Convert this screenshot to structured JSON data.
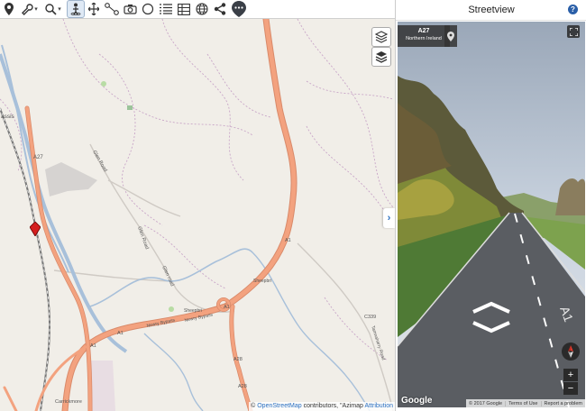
{
  "toolbar": {
    "tools": [
      {
        "name": "place-pin-icon"
      },
      {
        "name": "wrench-icon",
        "dropdown": true
      },
      {
        "name": "search-icon",
        "dropdown": true
      },
      {
        "name": "streetview-person-icon",
        "active": true
      },
      {
        "name": "pan-arrows-icon"
      },
      {
        "name": "route-nodes-icon"
      },
      {
        "name": "camera-icon"
      },
      {
        "name": "circle-icon"
      },
      {
        "name": "list-icon"
      },
      {
        "name": "table-grid-icon"
      },
      {
        "name": "globe-icon"
      },
      {
        "name": "share-icon"
      },
      {
        "name": "www-pin-icon"
      }
    ]
  },
  "map": {
    "labels": {
      "passloc": "assis",
      "a27_left": "A27",
      "glen_road_1": "Glen Road",
      "glen_road_2": "Glen Road",
      "glen_road_3": "Glen road",
      "sheepbridge_1": "Sheepbri",
      "sheepbridge_2": "Sheepbri",
      "newry_bypass_1": "Newry Bypass",
      "newry_bypass_2": "Newry Bypass",
      "a1_top": "A1",
      "a1_mid": "A1",
      "a1_left": "A1",
      "a1_lower": "A1",
      "a28_1": "A28",
      "a28_2": "A28",
      "c339": "C339",
      "tamnaharry_road": "Tamnaharry Road",
      "carrickmore": "Carrickmore"
    },
    "attribution": {
      "prefix": "©",
      "osm": "OpenStreetMap",
      "contributors": "contributors, \"Azimap",
      "link": "Attribution"
    },
    "collapse_glyph": "›"
  },
  "panel": {
    "title": "Streetview",
    "help": "?",
    "address_road": "A27",
    "address_region": "Northern Ireland",
    "google": "Google",
    "footer": [
      "© 2017 Google",
      "Terms of Use",
      "Report a problem"
    ],
    "zoom_in": "+",
    "zoom_out": "−",
    "road_marking": "A1"
  },
  "colors": {
    "map_bg": "#f1eee8",
    "main_road": "#f3a27f",
    "river": "#a8c0da",
    "sky": "#c9d3df",
    "accent": "#2a6fc0"
  }
}
